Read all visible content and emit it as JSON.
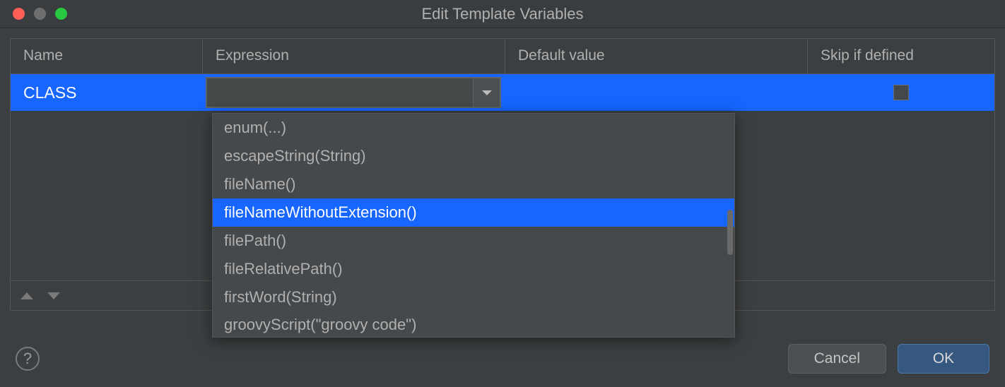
{
  "window": {
    "title": "Edit Template Variables"
  },
  "columns": {
    "name": "Name",
    "expression": "Expression",
    "default_value": "Default value",
    "skip_if_defined": "Skip if defined"
  },
  "rows": [
    {
      "name": "CLASS",
      "expression": "",
      "default_value": "",
      "skip_if_defined": false
    }
  ],
  "dropdown": {
    "items": [
      {
        "label": "enum(...)",
        "highlighted": false
      },
      {
        "label": "escapeString(String)",
        "highlighted": false
      },
      {
        "label": "fileName()",
        "highlighted": false
      },
      {
        "label": "fileNameWithoutExtension()",
        "highlighted": true
      },
      {
        "label": "filePath()",
        "highlighted": false
      },
      {
        "label": "fileRelativePath()",
        "highlighted": false
      },
      {
        "label": "firstWord(String)",
        "highlighted": false
      },
      {
        "label": "groovyScript(\"groovy code\")",
        "highlighted": false
      }
    ]
  },
  "buttons": {
    "help": "?",
    "cancel": "Cancel",
    "ok": "OK"
  }
}
